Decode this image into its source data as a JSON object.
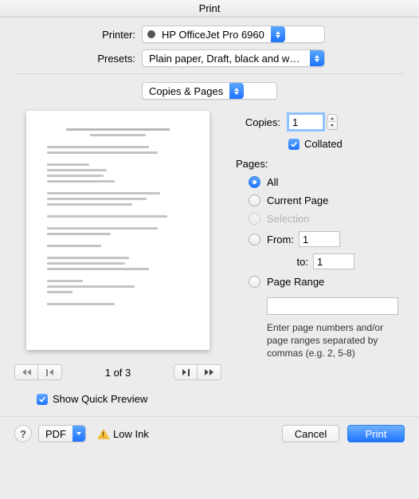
{
  "window": {
    "title": "Print"
  },
  "header": {
    "printer_label": "Printer:",
    "printer_value": "HP OfficeJet Pro 6960",
    "presets_label": "Presets:",
    "presets_value": "Plain paper, Draft, black and white",
    "section_select": "Copies & Pages"
  },
  "copies": {
    "label": "Copies:",
    "value": "1",
    "collated_label": "Collated",
    "collated_checked": true
  },
  "pages": {
    "heading": "Pages:",
    "all": "All",
    "current": "Current Page",
    "selection": "Selection",
    "from_label": "From:",
    "from_value": "1",
    "to_label": "to:",
    "to_value": "1",
    "range_label": "Page Range",
    "range_value": "",
    "hint": "Enter page numbers and/or page ranges separated by commas (e.g. 2, 5-8)",
    "selected": "all"
  },
  "preview": {
    "page_indicator": "1 of 3",
    "show_quick_label": "Show Quick Preview",
    "show_quick_checked": true
  },
  "footer": {
    "pdf_label": "PDF",
    "status_text": "Low Ink",
    "cancel": "Cancel",
    "print": "Print"
  }
}
